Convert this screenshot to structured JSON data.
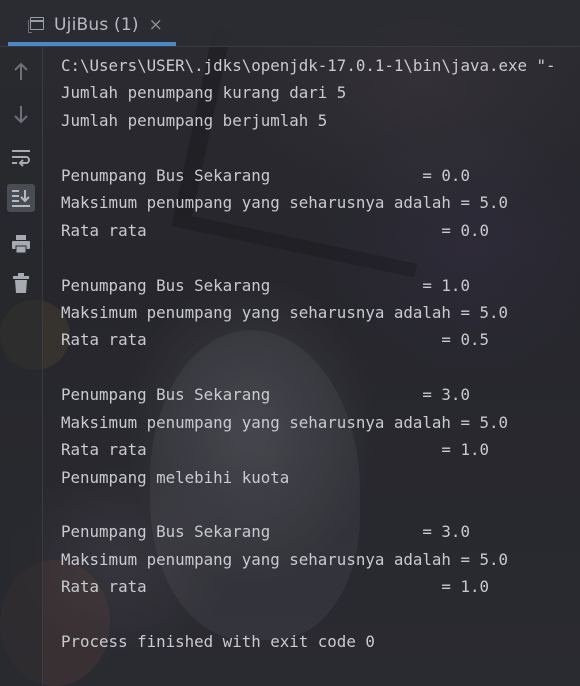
{
  "tab": {
    "title": "UjiBus (1)",
    "close_symbol": "×"
  },
  "toolbar": {
    "items": [
      {
        "icon": "arrow-up-icon",
        "label": "Up the Stack Trace"
      },
      {
        "icon": "arrow-down-icon",
        "label": "Down the Stack Trace"
      },
      {
        "icon": "soft-wrap-icon",
        "label": "Soft-Wrap"
      },
      {
        "icon": "scroll-to-end-icon",
        "label": "Scroll to the End",
        "active": true
      },
      {
        "icon": "print-icon",
        "label": "Print"
      },
      {
        "icon": "trash-icon",
        "label": "Clear All"
      }
    ]
  },
  "console": {
    "lines": [
      "C:\\Users\\USER\\.jdks\\openjdk-17.0.1-1\\bin\\java.exe \"-",
      "Jumlah penumpang kurang dari 5",
      "Jumlah penumpang berjumlah 5",
      "",
      "Penumpang Bus Sekarang                = 0.0",
      "Maksimum penumpang yang seharusnya adalah = 5.0",
      "Rata rata                               = 0.0",
      "",
      "Penumpang Bus Sekarang                = 1.0",
      "Maksimum penumpang yang seharusnya adalah = 5.0",
      "Rata rata                               = 0.5",
      "",
      "Penumpang Bus Sekarang                = 3.0",
      "Maksimum penumpang yang seharusnya adalah = 5.0",
      "Rata rata                               = 1.0",
      "Penumpang melebihi kuota",
      "",
      "Penumpang Bus Sekarang                = 3.0",
      "Maksimum penumpang yang seharusnya adalah = 5.0",
      "Rata rata                               = 1.0",
      "",
      "Process finished with exit code 0"
    ]
  },
  "colors": {
    "text": "#c9cbd0",
    "tab_underline": "#4a88c7",
    "icon": "#9a9ea6",
    "background": "#26262c"
  }
}
